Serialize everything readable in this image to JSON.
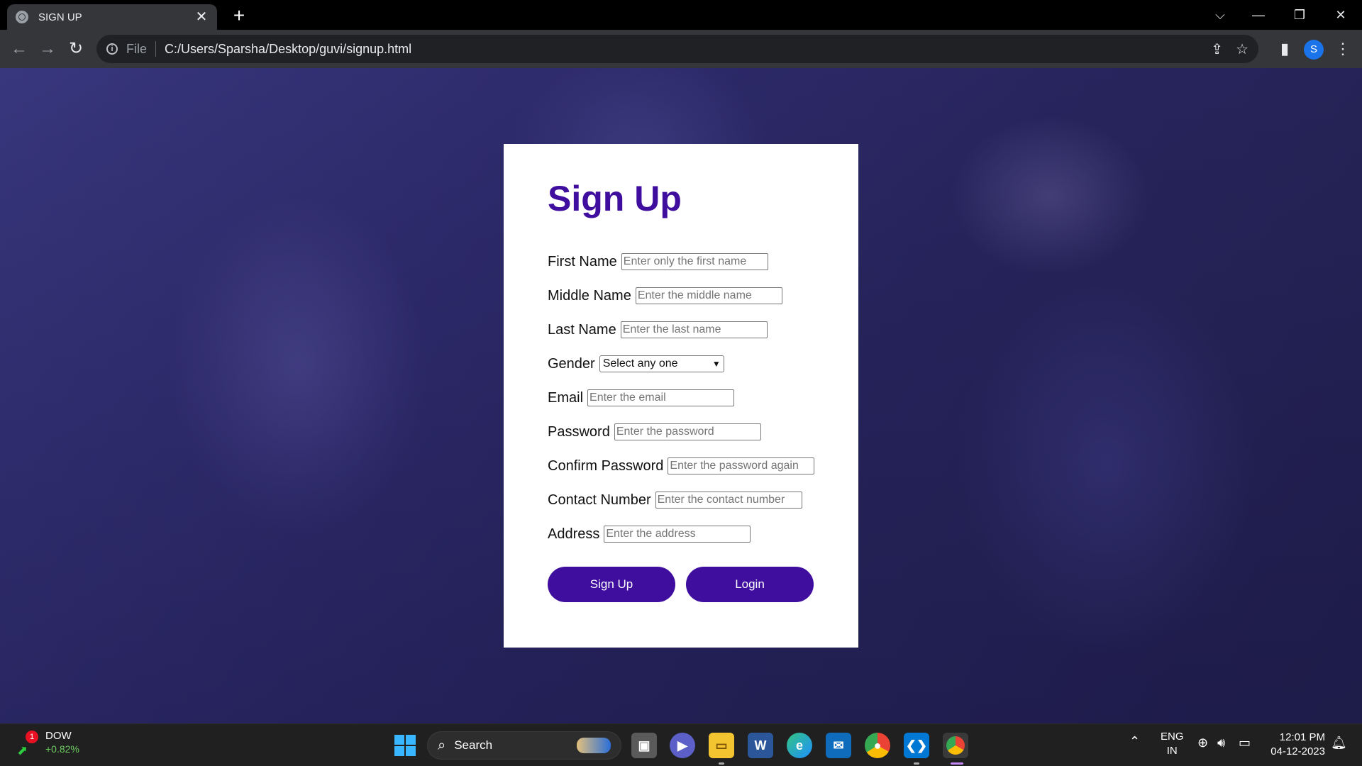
{
  "browser": {
    "tab_title": "SIGN UP",
    "tab_close": "✕",
    "new_tab": "+",
    "file_label": "File",
    "url": "C:/Users/Sparsha/Desktop/guvi/signup.html",
    "profile_initial": "S"
  },
  "form": {
    "heading": "Sign Up",
    "fields": [
      {
        "label": "First Name",
        "placeholder": "Enter only the first name"
      },
      {
        "label": "Middle Name",
        "placeholder": "Enter the middle name"
      },
      {
        "label": "Last Name",
        "placeholder": "Enter the last name"
      },
      {
        "label": "Gender",
        "selected": "Select any one"
      },
      {
        "label": "Email",
        "placeholder": "Enter the email"
      },
      {
        "label": "Password",
        "placeholder": "Enter the password"
      },
      {
        "label": "Confirm Password",
        "placeholder": "Enter the password again"
      },
      {
        "label": "Contact Number",
        "placeholder": "Enter the contact number"
      },
      {
        "label": "Address",
        "placeholder": "Enter the address"
      }
    ],
    "signup_button": "Sign Up",
    "login_button": "Login",
    "accent_color": "#3f0e9e"
  },
  "taskbar": {
    "widget_badge": "1",
    "widget_name": "DOW",
    "widget_value": "+0.82%",
    "search_label": "Search",
    "language_line1": "ENG",
    "language_line2": "IN",
    "time": "12:01 PM",
    "date": "04-12-2023",
    "apps": [
      "task-view-icon",
      "teams-icon",
      "file-explorer-icon",
      "word-icon",
      "edge-icon",
      "mail-icon",
      "chrome-icon",
      "vscode-icon",
      "chrome-profile-icon"
    ]
  }
}
